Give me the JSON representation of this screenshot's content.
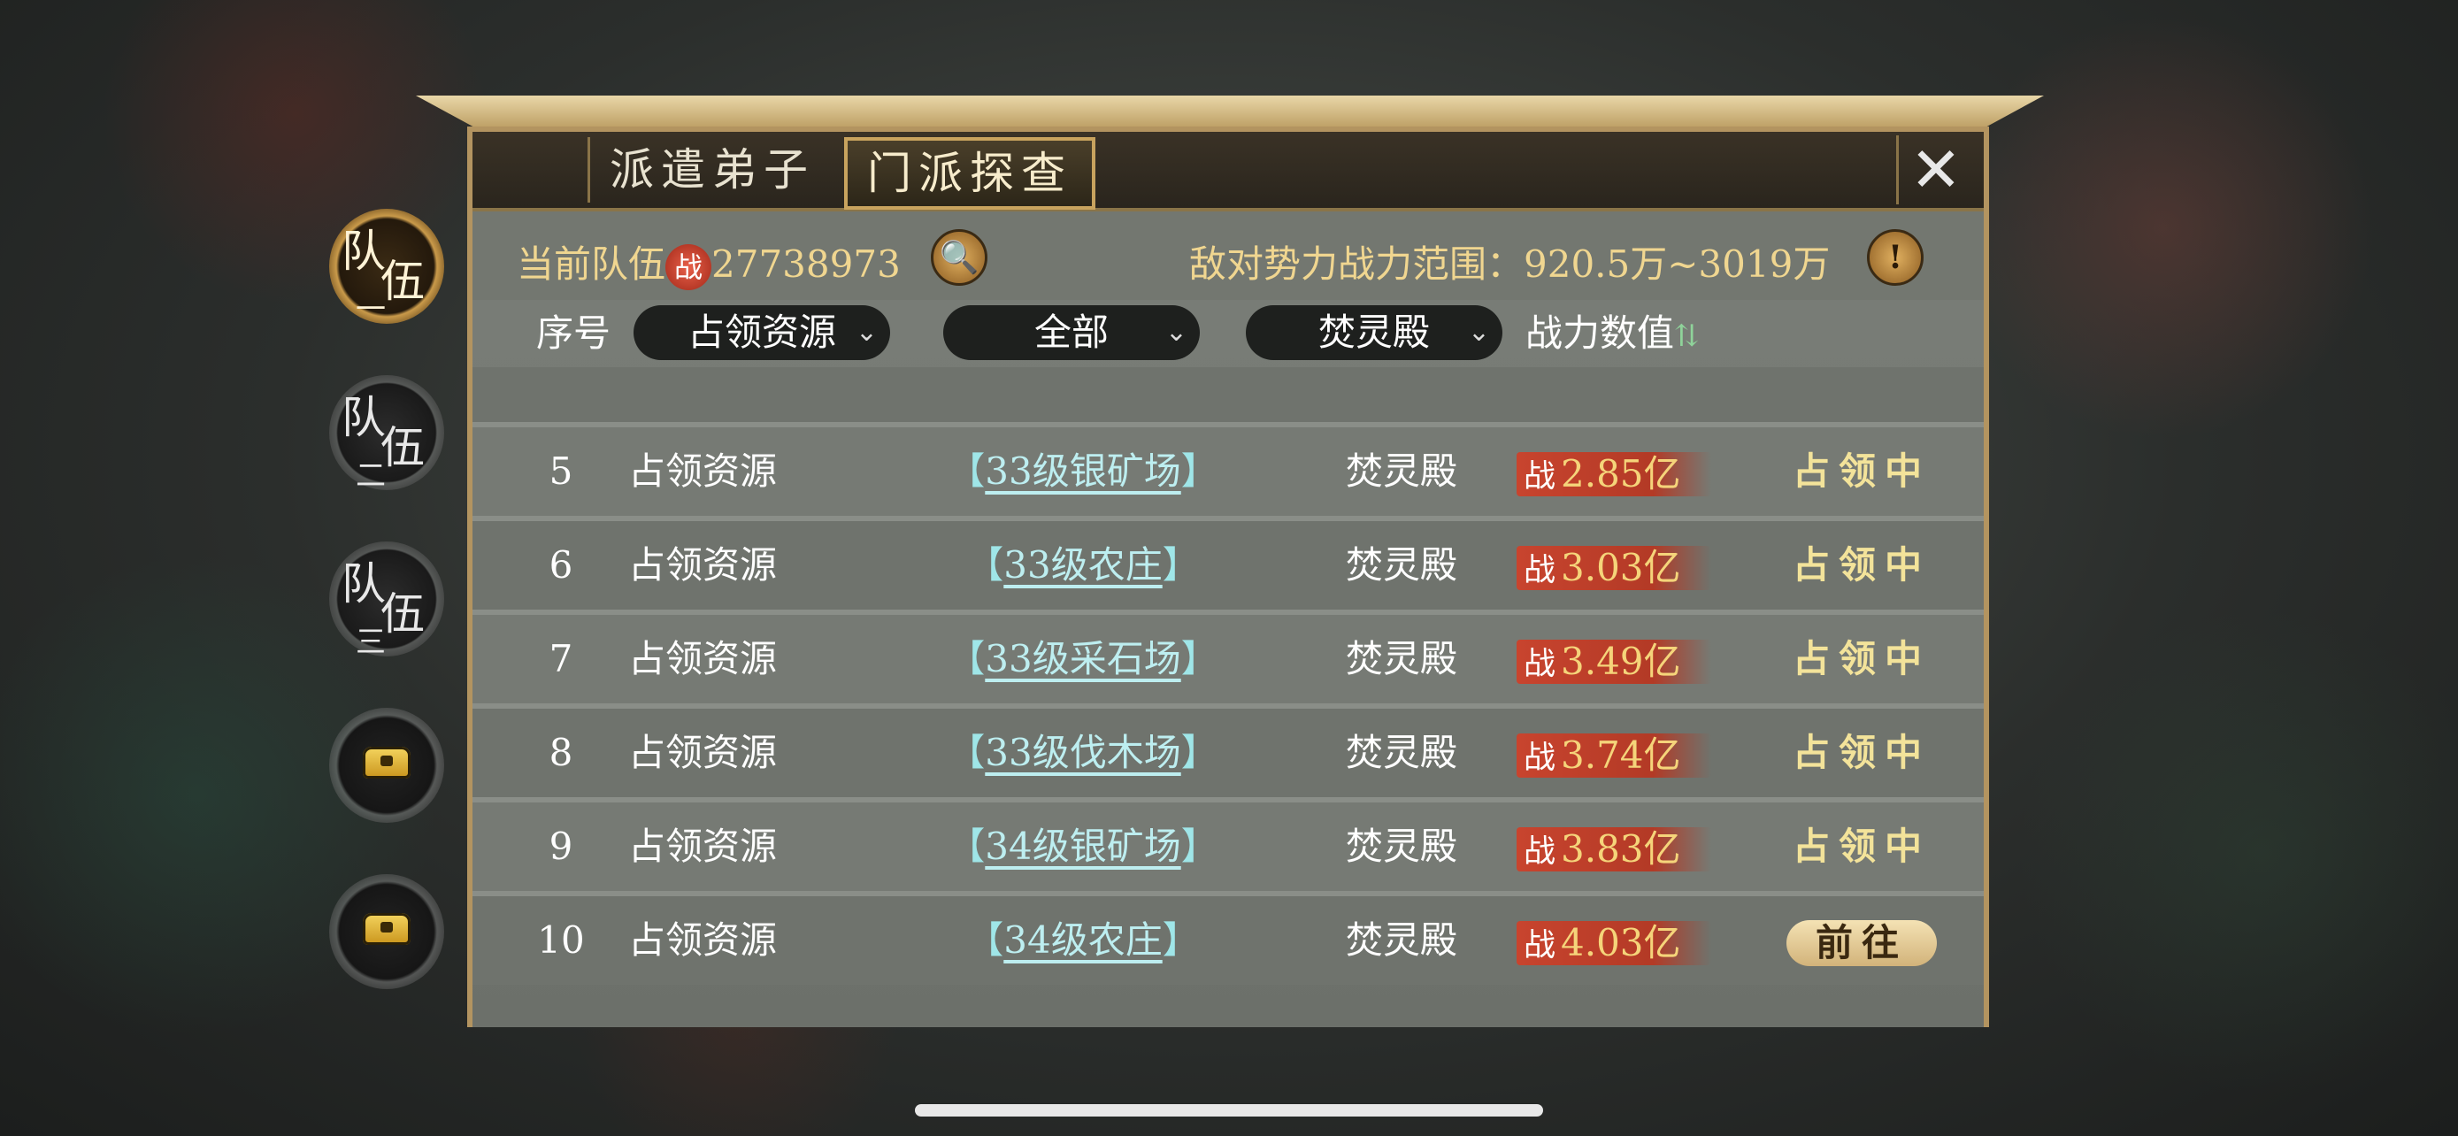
{
  "tabs": {
    "dispatch": "派遣弟子",
    "scout": "门派探查"
  },
  "side_tabs": [
    {
      "c1": "队",
      "c2": "伍",
      "c3": "一",
      "active": true
    },
    {
      "c1": "队",
      "c2": "伍",
      "c3": "二",
      "active": false
    },
    {
      "c1": "队",
      "c2": "伍",
      "c3": "三",
      "active": false
    }
  ],
  "header": {
    "team_label": "当前队伍",
    "power_glyph": "战",
    "team_power": "27738973",
    "enemy_label": "敌对势力战力范围：920.5万~3019万"
  },
  "filters": {
    "col_index": "序号",
    "action_filter": "占领资源",
    "target_filter": "全部",
    "sect_filter": "焚灵殿",
    "col_power": "战力数值",
    "sort_icon": "⇅"
  },
  "rows": [
    {
      "idx": "5",
      "type": "占领资源",
      "target": "33级银矿场",
      "sect": "焚灵殿",
      "power": "2.85亿",
      "status": "占领中",
      "action": ""
    },
    {
      "idx": "6",
      "type": "占领资源",
      "target": "33级农庄",
      "sect": "焚灵殿",
      "power": "3.03亿",
      "status": "占领中",
      "action": ""
    },
    {
      "idx": "7",
      "type": "占领资源",
      "target": "33级采石场",
      "sect": "焚灵殿",
      "power": "3.49亿",
      "status": "占领中",
      "action": ""
    },
    {
      "idx": "8",
      "type": "占领资源",
      "target": "33级伐木场",
      "sect": "焚灵殿",
      "power": "3.74亿",
      "status": "占领中",
      "action": ""
    },
    {
      "idx": "9",
      "type": "占领资源",
      "target": "34级银矿场",
      "sect": "焚灵殿",
      "power": "3.83亿",
      "status": "占领中",
      "action": ""
    },
    {
      "idx": "10",
      "type": "占领资源",
      "target": "34级农庄",
      "sect": "焚灵殿",
      "power": "4.03亿",
      "status": "",
      "action": "前往"
    }
  ],
  "brackets": {
    "open": "【",
    "close": "】"
  },
  "colors": {
    "gold": "#f0d690",
    "power_red": "#c8442e",
    "link_teal": "#bdeef0"
  }
}
